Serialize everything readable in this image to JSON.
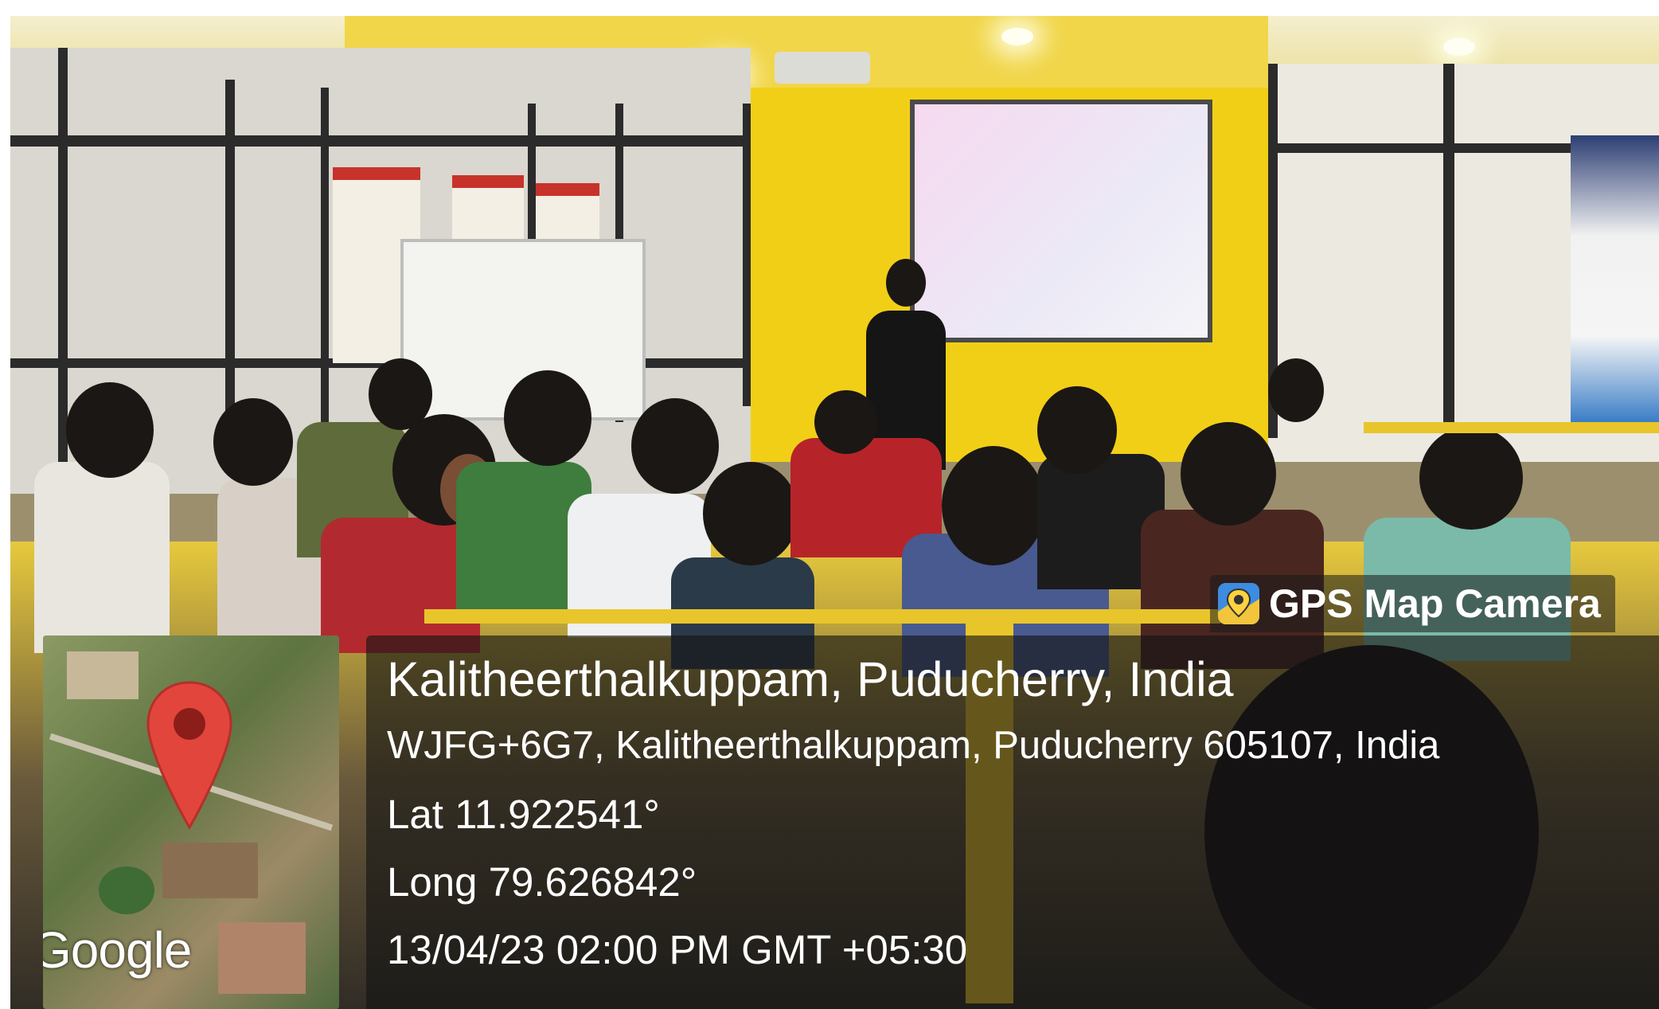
{
  "app": {
    "badge_label": "GPS Map Camera",
    "badge_icon": "map-camera-app-icon"
  },
  "location": {
    "title": "Kalitheerthalkuppam, Puducherry, India",
    "address": "WJFG+6G7, Kalitheerthalkuppam, Puducherry 605107, India",
    "latitude": "Lat 11.922541°",
    "longitude": "Long 79.626842°",
    "timestamp": "13/04/23 02:00 PM GMT +05:30"
  },
  "map": {
    "provider_logo": "Google",
    "pin_icon": "location-pin-icon",
    "pin_color": "#e2453c"
  },
  "colors": {
    "overlay_bg": "#141414",
    "overlay_text": "#ffffff",
    "badge_icon_bg": "#3c8ce0"
  }
}
